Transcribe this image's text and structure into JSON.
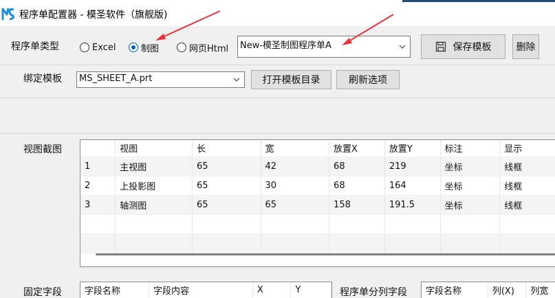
{
  "window": {
    "title": "程序单配置器 - 模圣软件（旗舰版)"
  },
  "type_row": {
    "label": "程序单类型",
    "options": [
      "Excel",
      "制图",
      "网页Html"
    ],
    "selected": "制图",
    "template_value": "New-模圣制图程序单A",
    "save_label": "保存模板",
    "delete_label": "删除"
  },
  "bind_row": {
    "label": "绑定模板",
    "value": "MS_SHEET_A.prt",
    "open_dir_label": "打开模板目录",
    "refresh_label": "刷新选项"
  },
  "views": {
    "label": "视图截图",
    "columns": [
      "",
      "视图",
      "长",
      "宽",
      "放置X",
      "放置Y",
      "标注",
      "显示"
    ],
    "rows": [
      [
        "1",
        "主视图",
        "65",
        "42",
        "68",
        "219",
        "坐标",
        "线框"
      ],
      [
        "2",
        "上投影图",
        "65",
        "30",
        "68",
        "164",
        "坐标",
        "线框"
      ],
      [
        "3",
        "轴测图",
        "65",
        "65",
        "158",
        "191.5",
        "坐标",
        "线框"
      ]
    ]
  },
  "fixed": {
    "label": "固定字段",
    "columns": [
      "字段名称",
      "字段内容",
      "X",
      "Y"
    ]
  },
  "split": {
    "label": "程序单分列字段",
    "columns": [
      "字段名称",
      "列(X)",
      "列宽"
    ]
  },
  "colors": {
    "accent": "#005fb8",
    "titlebar_accent": "#1e4e79",
    "annotation": "#e8333a"
  }
}
